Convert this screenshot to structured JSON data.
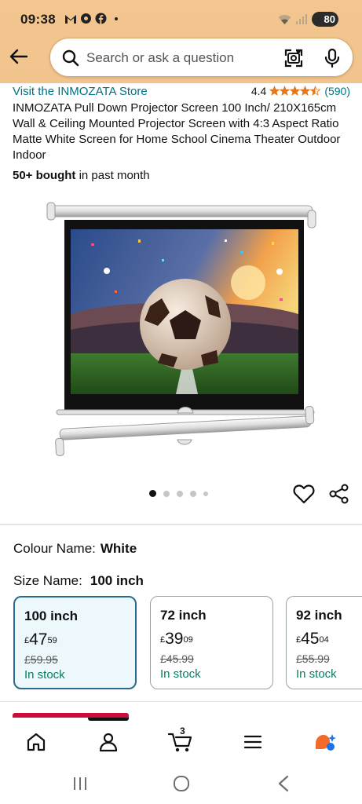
{
  "status_bar": {
    "time": "09:38",
    "battery": "80"
  },
  "search": {
    "placeholder": "Search or ask a question"
  },
  "product": {
    "store_link": "Visit the INMOZATA Store",
    "rating": "4.4",
    "rating_count": "(590)",
    "title": "INMOZATA Pull Down Projector Screen 100 Inch/ 210X165cm Wall & Ceiling Mounted Projector Screen with 4:3 Aspect Ratio Matte White Screen for Home School Cinema Theater Outdoor Indoor",
    "bought_bold": "50+ bought",
    "bought_rest": " in past month"
  },
  "variations": {
    "colour_label": "Colour Name:",
    "colour_value": "White",
    "size_label": "Size Name:",
    "size_value": "100 inch",
    "options": [
      {
        "name": "100 inch",
        "currency": "£",
        "whole": "47",
        "fraction": "59",
        "old": "£59.95",
        "stock": "In stock"
      },
      {
        "name": "72 inch",
        "currency": "£",
        "whole": "39",
        "fraction": "09",
        "old": "£45.99",
        "stock": "In stock"
      },
      {
        "name": "92 inch",
        "currency": "£",
        "whole": "45",
        "fraction": "04",
        "old": "£55.99",
        "stock": "In stock"
      }
    ]
  },
  "nav": {
    "cart_count": "3"
  },
  "icons": [
    "back-arrow-icon",
    "search-icon",
    "camera-icon",
    "mic-icon",
    "heart-icon",
    "share-icon",
    "home-icon",
    "account-icon",
    "cart-icon",
    "menu-icon",
    "rufus-icon"
  ],
  "colors": {
    "header": "#f2c48d",
    "link": "#007185",
    "stock": "#067d62",
    "selected_border": "#2a6a8f"
  }
}
